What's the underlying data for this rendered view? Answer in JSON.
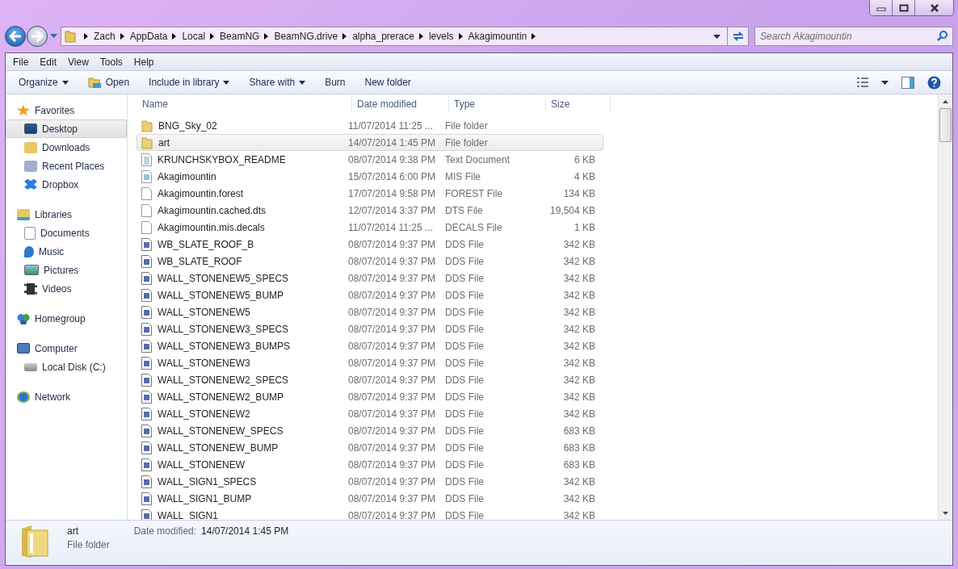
{
  "address": {
    "crumbs": [
      "Zach",
      "AppData",
      "Local",
      "BeamNG",
      "BeamNG.drive",
      "alpha_prerace",
      "levels",
      "Akagimountin"
    ]
  },
  "search": {
    "placeholder": "Search Akagimountin"
  },
  "menu": [
    "File",
    "Edit",
    "View",
    "Tools",
    "Help"
  ],
  "toolbar": [
    {
      "label": "Organize",
      "kind": "dropdown"
    },
    {
      "label": "Open",
      "kind": "open"
    },
    {
      "label": "Include in library",
      "kind": "dropdown"
    },
    {
      "label": "Share with",
      "kind": "dropdown"
    },
    {
      "label": "Burn",
      "kind": "plain"
    },
    {
      "label": "New folder",
      "kind": "plain"
    }
  ],
  "sidebar": [
    {
      "label": "Favorites",
      "selected": false,
      "children": [
        {
          "label": "Desktop",
          "selected": true
        },
        {
          "label": "Downloads",
          "selected": false
        },
        {
          "label": "Recent Places",
          "selected": false
        },
        {
          "label": "Dropbox",
          "selected": false
        }
      ]
    },
    {
      "label": "Libraries",
      "selected": false,
      "children": [
        {
          "label": "Documents",
          "selected": false
        },
        {
          "label": "Music",
          "selected": false
        },
        {
          "label": "Pictures",
          "selected": false
        },
        {
          "label": "Videos",
          "selected": false
        }
      ]
    },
    {
      "label": "Homegroup",
      "selected": false
    },
    {
      "label": "Computer",
      "selected": false,
      "children": [
        {
          "label": "Local Disk (C:)",
          "selected": false
        }
      ]
    },
    {
      "label": "Network",
      "selected": false
    }
  ],
  "table": {
    "columns": [
      "Name",
      "Date modified",
      "Type",
      "Size"
    ],
    "rows": [
      {
        "kind": "folder",
        "name": "BNG_Sky_02",
        "date": "11/07/2014 11:25 ...",
        "type": "File folder",
        "selected": false
      },
      {
        "kind": "folder",
        "name": "art",
        "date": "14/07/2014 1:45 PM",
        "type": "File folder",
        "selected": true
      },
      {
        "kind": "text",
        "name": "KRUNCHSKYBOX_README",
        "date": "08/07/2014 9:38 PM",
        "type": "Text Document",
        "size": "6 KB",
        "selected": false
      },
      {
        "kind": "mis",
        "name": "Akagimountin",
        "date": "15/07/2014 6:00 PM",
        "type": "MIS File",
        "size": "4 KB",
        "selected": false
      },
      {
        "kind": "blank",
        "name": "Akagimountin.forest",
        "date": "17/07/2014 9:58 PM",
        "type": "FOREST File",
        "size": "134 KB",
        "selected": false
      },
      {
        "kind": "blank",
        "name": "Akagimountin.cached.dts",
        "date": "12/07/2014 3:37 PM",
        "type": "DTS File",
        "size": "19,504 KB",
        "selected": false
      },
      {
        "kind": "blank",
        "name": "Akagimountin.mis.decals",
        "date": "11/07/2014 11:25 ...",
        "type": "DECALS File",
        "size": "1 KB",
        "selected": false
      },
      {
        "kind": "image",
        "name": "WB_SLATE_ROOF_B",
        "date": "08/07/2014 9:37 PM",
        "type": "DDS File",
        "size": "342 KB",
        "selected": false
      },
      {
        "kind": "image",
        "name": "WB_SLATE_ROOF",
        "date": "08/07/2014 9:37 PM",
        "type": "DDS File",
        "size": "342 KB",
        "selected": false
      },
      {
        "kind": "image",
        "name": "WALL_STONENEW5_SPECS",
        "date": "08/07/2014 9:37 PM",
        "type": "DDS File",
        "size": "342 KB",
        "selected": false
      },
      {
        "kind": "image",
        "name": "WALL_STONENEW5_BUMP",
        "date": "08/07/2014 9:37 PM",
        "type": "DDS File",
        "size": "342 KB",
        "selected": false
      },
      {
        "kind": "image",
        "name": "WALL_STONENEW5",
        "date": "08/07/2014 9:37 PM",
        "type": "DDS File",
        "size": "342 KB",
        "selected": false
      },
      {
        "kind": "image",
        "name": "WALL_STONENEW3_SPECS",
        "date": "08/07/2014 9:37 PM",
        "type": "DDS File",
        "size": "342 KB",
        "selected": false
      },
      {
        "kind": "image",
        "name": "WALL_STONENEW3_BUMPS",
        "date": "08/07/2014 9:37 PM",
        "type": "DDS File",
        "size": "342 KB",
        "selected": false
      },
      {
        "kind": "image",
        "name": "WALL_STONENEW3",
        "date": "08/07/2014 9:37 PM",
        "type": "DDS File",
        "size": "342 KB",
        "selected": false
      },
      {
        "kind": "image",
        "name": "WALL_STONENEW2_SPECS",
        "date": "08/07/2014 9:37 PM",
        "type": "DDS File",
        "size": "342 KB",
        "selected": false
      },
      {
        "kind": "image",
        "name": "WALL_STONENEW2_BUMP",
        "date": "08/07/2014 9:37 PM",
        "type": "DDS File",
        "size": "342 KB",
        "selected": false
      },
      {
        "kind": "image",
        "name": "WALL_STONENEW2",
        "date": "08/07/2014 9:37 PM",
        "type": "DDS File",
        "size": "342 KB",
        "selected": false
      },
      {
        "kind": "image",
        "name": "WALL_STONENEW_SPECS",
        "date": "08/07/2014 9:37 PM",
        "type": "DDS File",
        "size": "683 KB",
        "selected": false
      },
      {
        "kind": "image",
        "name": "WALL_STONENEW_BUMP",
        "date": "08/07/2014 9:37 PM",
        "type": "DDS File",
        "size": "683 KB",
        "selected": false
      },
      {
        "kind": "image",
        "name": "WALL_STONENEW",
        "date": "08/07/2014 9:37 PM",
        "type": "DDS File",
        "size": "683 KB",
        "selected": false
      },
      {
        "kind": "image",
        "name": "WALL_SIGN1_SPECS",
        "date": "08/07/2014 9:37 PM",
        "type": "DDS File",
        "size": "342 KB",
        "selected": false
      },
      {
        "kind": "image",
        "name": "WALL_SIGN1_BUMP",
        "date": "08/07/2014 9:37 PM",
        "type": "DDS File",
        "size": "342 KB",
        "selected": false
      },
      {
        "kind": "image",
        "name": "WALL_SIGN1",
        "date": "08/07/2014 9:37 PM",
        "type": "DDS File",
        "size": "342 KB",
        "selected": false
      }
    ]
  },
  "details": {
    "name": "art",
    "date_label": "Date modified:",
    "date": "14/07/2014 1:45 PM",
    "type": "File folder"
  }
}
